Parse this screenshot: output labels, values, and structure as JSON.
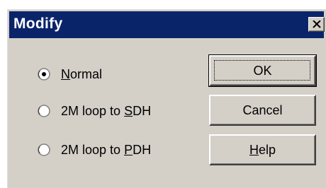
{
  "dialog": {
    "title": "Modify",
    "close_icon": "close-icon"
  },
  "options": [
    {
      "label_pre": "",
      "accel": "N",
      "label_post": "ormal",
      "checked": true
    },
    {
      "label_pre": "2M loop to ",
      "accel": "S",
      "label_post": "DH",
      "checked": false
    },
    {
      "label_pre": "2M loop to ",
      "accel": "P",
      "label_post": "DH",
      "checked": false
    }
  ],
  "buttons": {
    "ok": {
      "label": "OK"
    },
    "cancel": {
      "label": "Cancel"
    },
    "help": {
      "label_accel": "H",
      "label_post": "elp"
    }
  },
  "colors": {
    "titlebar": "#0a246a",
    "face": "#d4d0c8"
  }
}
